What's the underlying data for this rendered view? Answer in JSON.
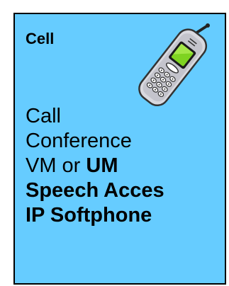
{
  "card": {
    "title": "Cell",
    "icon": "cell-phone-icon",
    "background_color": "#66ccff",
    "border_color": "#000000",
    "items": [
      {
        "text": "Call"
      },
      {
        "text": "Conference"
      },
      {
        "prefix": "VM or ",
        "emphasis": "UM"
      },
      {
        "text": "Speech Acces"
      },
      {
        "text": "IP Softphone"
      }
    ]
  }
}
